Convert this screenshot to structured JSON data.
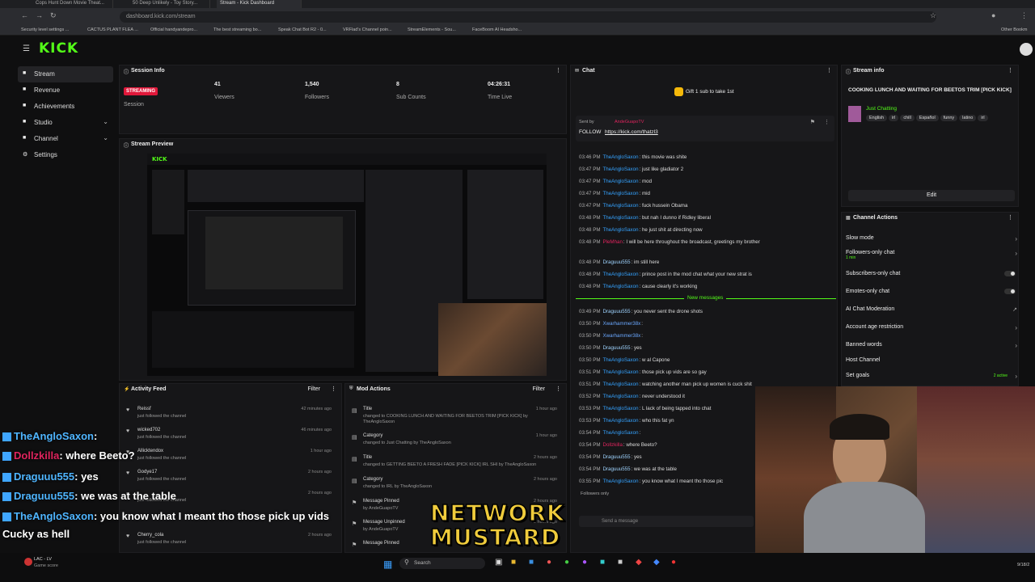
{
  "browser": {
    "tabs": [
      "Cops Hunt Down Movie Theat...",
      "50 Deep Unlikely - Toy Story...",
      "Stream - Kick Dashboard"
    ],
    "url": "dashboard.kick.com/stream",
    "bookmarks": [
      "Security level settings ...",
      "CACTUS PLANT FLEA ...",
      "Official handyandepro...",
      "The best streaming bo...",
      "Speak Chat Bot R2 - 0...",
      "VRFlad's Channel poin...",
      "StreamElements - Sou...",
      "FaceBoom AI Headsho...",
      "Other Bookm"
    ]
  },
  "app": {
    "logo": "KICK"
  },
  "sidebar": {
    "items": [
      {
        "label": "Stream",
        "icon": "video-icon",
        "active": true
      },
      {
        "label": "Revenue",
        "icon": "money-icon"
      },
      {
        "label": "Achievements",
        "icon": "trophy-icon"
      },
      {
        "label": "Studio",
        "icon": "studio-icon"
      },
      {
        "label": "Channel",
        "icon": "channel-icon"
      },
      {
        "label": "Settings",
        "icon": "gear-icon"
      }
    ]
  },
  "session": {
    "title": "Session Info",
    "status": "STREAMING",
    "status_label": "Session",
    "stats": [
      {
        "value": "41",
        "label": "Viewers"
      },
      {
        "value": "1,540",
        "label": "Followers"
      },
      {
        "value": "8",
        "label": "Sub Counts"
      },
      {
        "value": "04:26:31",
        "label": "Time Live"
      }
    ]
  },
  "preview": {
    "title": "Stream Preview"
  },
  "activity": {
    "title": "Activity Feed",
    "filter": "Filter",
    "items": [
      {
        "name": "Reissf",
        "sub": "just followed the channel",
        "time": "42 minutes ago"
      },
      {
        "name": "wicked702",
        "sub": "just followed the channel",
        "time": "46 minutes ago"
      },
      {
        "name": "Allicktendox",
        "sub": "just followed the channel",
        "time": "1 hour ago"
      },
      {
        "name": "Godye17",
        "sub": "just followed the channel",
        "time": "2 hours ago"
      },
      {
        "name": "",
        "sub": "just followed the channel",
        "time": "2 hours ago"
      },
      {
        "name": "Cherry_cola",
        "sub": "just followed the channel",
        "time": "2 hours ago"
      }
    ]
  },
  "mod": {
    "title": "Mod Actions",
    "filter": "Filter",
    "items": [
      {
        "name": "Title",
        "sub": "changed to COOKING LUNCH AND WAITING FOR BEETOS TRIM [PICK KICK] by TheAngloSaxon",
        "time": "1 hour ago"
      },
      {
        "name": "Category",
        "sub": "changed to Just Chatting by TheAngloSaxon",
        "time": "1 hour ago"
      },
      {
        "name": "Title",
        "sub": "changed to GETTING BEETO A FRESH FADE [PICK KICK] IRL SHI by TheAngloSaxon",
        "time": "2 hours ago"
      },
      {
        "name": "Category",
        "sub": "changed to IRL by TheAngloSaxon",
        "time": "2 hours ago"
      },
      {
        "name": "Message Pinned",
        "sub": "by AndeGuapoTV",
        "time": "2 hours ago"
      },
      {
        "name": "Message Unpinned",
        "sub": "by AndeGuapoTV",
        "time": "2 hours ago"
      },
      {
        "name": "Message Pinned",
        "sub": "",
        "time": "2 hours ago"
      }
    ]
  },
  "chat": {
    "title": "Chat",
    "gift": "Gift 1 sub to take 1st",
    "pinned_by": "Sent by",
    "pinned_user": "AndeGuapoTV",
    "pinned_text": "FOLLOW",
    "pinned_link": "https://kick.com/thatzl3",
    "new_messages": "New messages",
    "followers_only": "Followers only",
    "send_placeholder": "Send a message",
    "messages": [
      {
        "t": "03:46 PM",
        "u": "TheAngloSaxon",
        "m": "this movie was shite"
      },
      {
        "t": "03:47 PM",
        "u": "TheAngloSaxon",
        "m": "just like gladiator 2"
      },
      {
        "t": "03:47 PM",
        "u": "TheAngloSaxon",
        "m": "mod"
      },
      {
        "t": "03:47 PM",
        "u": "TheAngloSaxon",
        "m": "mid"
      },
      {
        "t": "03:47 PM",
        "u": "TheAngloSaxon",
        "m": "fuck hussein Obama"
      },
      {
        "t": "03:48 PM",
        "u": "TheAngloSaxon",
        "m": "but nah I dunno if Ridley liberal"
      },
      {
        "t": "03:48 PM",
        "u": "TheAngloSaxon",
        "m": "he just shit at directing now"
      },
      {
        "t": "03:48 PM",
        "u": "PleMhan",
        "m": "I will be here throughout the broadcast, greetings my brother"
      },
      {
        "t": "03:48 PM",
        "u": "Draguuu555",
        "m": "im still here"
      },
      {
        "t": "03:48 PM",
        "u": "TheAngloSaxon",
        "m": "prince post in the mod chat what your new strat is"
      },
      {
        "t": "03:48 PM",
        "u": "TheAngloSaxon",
        "m": "cause clearly it's working"
      },
      {
        "t": "03:49 PM",
        "u": "Draguuu555",
        "m": "you never sent the drone shots"
      },
      {
        "t": "03:50 PM",
        "u": "Xwarhammer38x",
        "m": ""
      },
      {
        "t": "03:50 PM",
        "u": "Xwarhammer38x",
        "m": ""
      },
      {
        "t": "03:50 PM",
        "u": "Draguuu555",
        "m": "yes"
      },
      {
        "t": "03:50 PM",
        "u": "TheAngloSaxon",
        "m": "w al Capone"
      },
      {
        "t": "03:51 PM",
        "u": "TheAngloSaxon",
        "m": "those pick up vids are so gay"
      },
      {
        "t": "03:51 PM",
        "u": "TheAngloSaxon",
        "m": "watching another man pick up women is cuck shit"
      },
      {
        "t": "03:52 PM",
        "u": "TheAngloSaxon",
        "m": "never understood it"
      },
      {
        "t": "03:53 PM",
        "u": "TheAngloSaxon",
        "m": "L lack of being tapped into chat"
      },
      {
        "t": "03:53 PM",
        "u": "TheAngloSaxon",
        "m": "who this fat yn"
      },
      {
        "t": "03:54 PM",
        "u": "TheAngloSaxon",
        "m": ""
      },
      {
        "t": "03:54 PM",
        "u": "Dollzkilla",
        "m": "where Beeto?"
      },
      {
        "t": "03:54 PM",
        "u": "Draguuu555",
        "m": "yes"
      },
      {
        "t": "03:54 PM",
        "u": "Draguuu555",
        "m": "we was at the table"
      },
      {
        "t": "03:55 PM",
        "u": "TheAngloSaxon",
        "m": "you know what I meant tho those pic"
      }
    ]
  },
  "stream_info": {
    "title": "Stream info",
    "stream_title": "COOKING LUNCH AND WAITING FOR BEETOS TRIM [PICK KICK]",
    "category": "Just Chatting",
    "tags": [
      "English",
      "irl",
      "chill",
      "Español",
      "funny",
      "latino",
      "irl"
    ],
    "edit": "Edit"
  },
  "actions": {
    "title": "Channel Actions",
    "items": [
      {
        "label": "Slow mode",
        "sub": "",
        "type": "arrow"
      },
      {
        "label": "Followers-only chat",
        "sub": "1 min",
        "type": "arrow"
      },
      {
        "label": "Subscribers-only chat",
        "sub": "",
        "type": "toggle"
      },
      {
        "label": "Emotes-only chat",
        "sub": "",
        "type": "toggle"
      },
      {
        "label": "AI Chat Moderation",
        "sub": "",
        "type": "link"
      },
      {
        "label": "Account age restriction",
        "sub": "",
        "type": "arrow"
      },
      {
        "label": "Banned words",
        "sub": "",
        "type": "arrow"
      },
      {
        "label": "Host Channel",
        "sub": "",
        "type": "none"
      },
      {
        "label": "Set goals",
        "sub": "2 active",
        "type": "arrow"
      }
    ]
  },
  "overlay_chat": [
    {
      "u": "TheAngloSaxon",
      "m": ":"
    },
    {
      "u": "Dollzkilla",
      "m": ": where Beeto?"
    },
    {
      "u": "Draguuu555",
      "m": ": yes"
    },
    {
      "u": "Draguuu555",
      "m": ": we was at the table"
    },
    {
      "u": "TheAngloSaxon",
      "m": ": you know what I meant tho those pick up vids"
    },
    {
      "u": "",
      "m": "Cucky as hell"
    }
  ],
  "watermark": [
    "NETWORK",
    "MUSTARD"
  ],
  "taskbar": {
    "weather_line1": "LAC - LV",
    "weather_line2": "Game score",
    "search": "Search",
    "time": "9/18/2"
  },
  "colors": {
    "accent": "#53fc18",
    "live": "#e0183a",
    "username": "#35a3ff"
  }
}
